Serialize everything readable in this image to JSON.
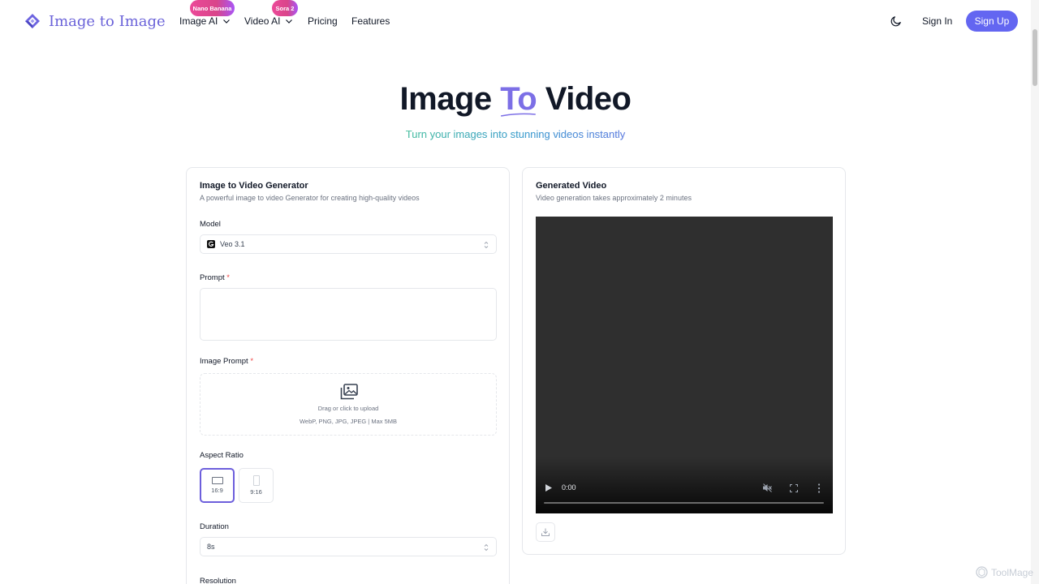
{
  "header": {
    "brand": "Image to Image",
    "nav": [
      {
        "label": "Image AI",
        "badge": "Nano Banana"
      },
      {
        "label": "Video AI",
        "badge": "Sora 2"
      },
      {
        "label": "Pricing"
      },
      {
        "label": "Features"
      }
    ],
    "sign_in": "Sign In",
    "sign_up": "Sign Up"
  },
  "hero": {
    "title_part1": "Image",
    "title_highlight": "To",
    "title_part2": "Video",
    "subtitle": "Turn your images into stunning videos instantly"
  },
  "generator": {
    "title": "Image to Video Generator",
    "description": "A powerful image to video Generator for creating high-quality videos",
    "model_label": "Model",
    "model_value": "Veo 3.1",
    "prompt_label": "Prompt",
    "required_mark": "*",
    "prompt_value": "",
    "image_prompt_label": "Image Prompt",
    "upload_text": "Drag or click to upload",
    "upload_hint": "WebP, PNG, JPG, JPEG | Max 5MB",
    "aspect_ratio_label": "Aspect Ratio",
    "aspect_ratios": [
      {
        "label": "16:9",
        "selected": true
      },
      {
        "label": "9:16",
        "selected": false
      }
    ],
    "duration_label": "Duration",
    "duration_value": "8s",
    "resolution_label": "Resolution"
  },
  "output": {
    "title": "Generated Video",
    "description": "Video generation takes approximately 2 minutes",
    "video_time": "0:00"
  },
  "watermark": "ToolMage",
  "colors": {
    "accent": "#6366f1",
    "brand_text": "#6b63d9",
    "badge_pink": "#ec4899",
    "required": "#ef4444",
    "video_bg": "#2f2f2f"
  }
}
